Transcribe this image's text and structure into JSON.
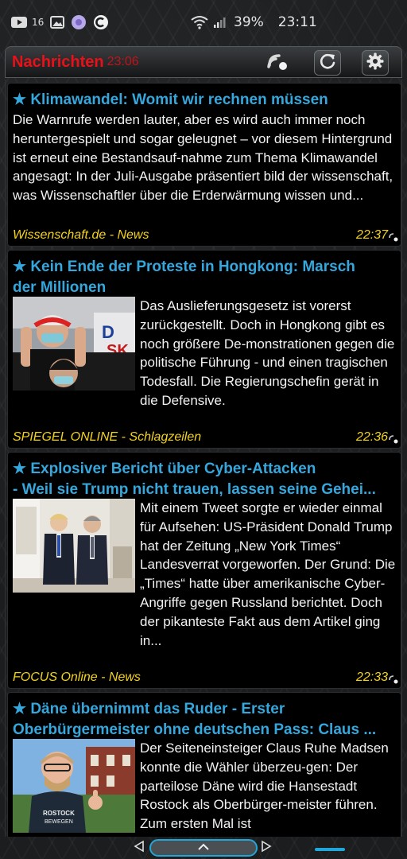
{
  "status_bar": {
    "notification_count": "16",
    "battery_percent": "39%",
    "time": "23:11"
  },
  "header": {
    "app_name": "Nachrichten",
    "updated_time": "23:06"
  },
  "articles": [
    {
      "title": "Klimawandel: Womit wir rechnen müssen",
      "title_line2": "",
      "description": "Die Warnrufe werden lauter, aber es wird auch immer noch heruntergespielt und sogar geleugnet – vor diesem Hintergrund ist erneut eine Bestandsauf-nahme zum Thema Klimawandel angesagt: In der Juli-Ausgabe präsentiert bild der wissenschaft, was Wissenschaftler über die Erderwärmung wissen und...",
      "source": "Wissenschaft.de - News",
      "time": "22:37",
      "has_image": false
    },
    {
      "title": "Kein Ende der Proteste in Hongkong: Marsch",
      "title_line2": "der Millionen",
      "description": "Das Auslieferungsgesetz ist vorerst zurückgestellt. Doch in Hongkong gibt es noch größere De-monstrationen gegen die politische Führung - und einen tragischen Todesfall. Die Regierungschefin gerät in die Defensive.",
      "source": "SPIEGEL ONLINE - Schlagzeilen",
      "time": "22:36",
      "has_image": true
    },
    {
      "title": "Explosiver Bericht über Cyber-Attacken",
      "title_line2": "- Weil sie Trump nicht trauen, lassen seine Gehei...",
      "description": "Mit einem Tweet sorgte er wieder einmal für Aufsehen: US-Präsident Donald Trump hat der Zeitung „New York Times“ Landesverrat vorgeworfen. Der Grund: Die „Times“ hatte über amerikanische Cyber-Angriffe gegen Russland berichtet. Doch der pikanteste Fakt aus dem Artikel ging in...",
      "source": "FOCUS Online - News",
      "time": "22:33",
      "has_image": true
    },
    {
      "title": "Däne übernimmt das Ruder - Erster",
      "title_line2": "Oberbürgermeister ohne deutschen Pass: Claus ...",
      "description": "Der Seiteneinsteiger Claus Ruhe Madsen konnte die Wähler überzeu-gen: Der parteilose Däne wird die Hansestadt Rostock als Oberbürger-meister führen. Zum ersten Mal ist",
      "source": "",
      "time": "",
      "has_image": true
    }
  ],
  "colors": {
    "title": "#35a7dc",
    "source": "#f4d21a",
    "app_name": "#e8111a",
    "accent": "#21a6d8"
  },
  "icons": {
    "header": [
      "wifi-feed-icon",
      "refresh-icon",
      "settings-icon"
    ],
    "nav": [
      "back-icon",
      "home-pill-icon",
      "forward-icon"
    ]
  }
}
